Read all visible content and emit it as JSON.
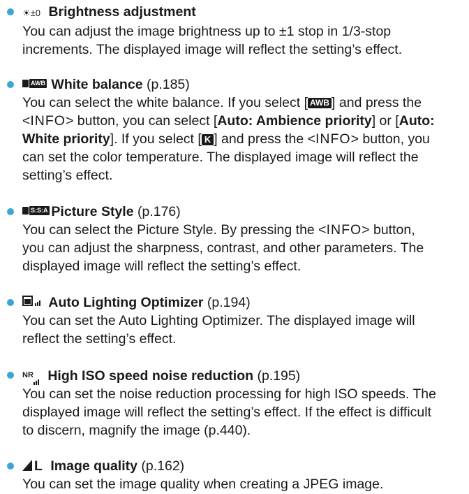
{
  "colors": {
    "bullet": "#3aa6d6"
  },
  "items": [
    {
      "icon": "brightness-adjust-icon",
      "icon_text": "☀±0",
      "title": "Brightness adjustment",
      "ref": "",
      "body_lines": [
        "You can adjust the image brightness up to ±1 stop in 1/3-stop",
        "increments. The displayed image will reflect the setting’s effect."
      ]
    },
    {
      "icon": "white-balance-tab-icon",
      "icon_text": "AWB",
      "title": "White balance",
      "ref": "(p.185)",
      "body": {
        "l1a": "You can select the white balance. If you select [",
        "awb": "AWB",
        "l1b": "] and press the",
        "l2a": "<",
        "info1": "INFO",
        "l2b": "> button, you can select [",
        "ambience": "Auto: Ambience priority",
        "l2c": "] or [",
        "auto": "Auto:",
        "white": "White priority",
        "l3a": "]. If you select [",
        "k": "K",
        "l3b": "] and press the <",
        "info2": "INFO",
        "l3c": "> button, you",
        "l4": "can set the color temperature. The displayed image will reflect the",
        "l5": "setting’s effect."
      }
    },
    {
      "icon": "picture-style-tab-icon",
      "icon_text": "S:S:A",
      "title": "Picture Style",
      "ref": "(p.176)",
      "body": {
        "l1": "You can select the Picture Style. By pressing the <",
        "info": "INFO",
        "l1b": "> button,",
        "l2": "you can adjust the sharpness, contrast, and other parameters. The",
        "l3": "displayed image will reflect the setting’s effect."
      }
    },
    {
      "icon": "auto-lighting-optimizer-icon",
      "title": "Auto Lighting Optimizer",
      "ref": "(p.194)",
      "body_lines": [
        "You can set the Auto Lighting Optimizer. The displayed image will",
        "reflect the setting’s effect."
      ]
    },
    {
      "icon": "noise-reduction-icon",
      "icon_text": "NR",
      "title": "High ISO speed noise reduction",
      "ref": "(p.195)",
      "body_lines": [
        "You can set the noise reduction processing for high ISO speeds. The",
        "displayed image will reflect the setting’s effect. If the effect is difficult",
        "to discern, magnify the image (p.440)."
      ]
    },
    {
      "icon": "image-quality-icon",
      "icon_text": "L",
      "title": "Image quality",
      "ref": "(p.162)",
      "body_lines": [
        "You can set the image quality when creating a JPEG image."
      ]
    }
  ]
}
